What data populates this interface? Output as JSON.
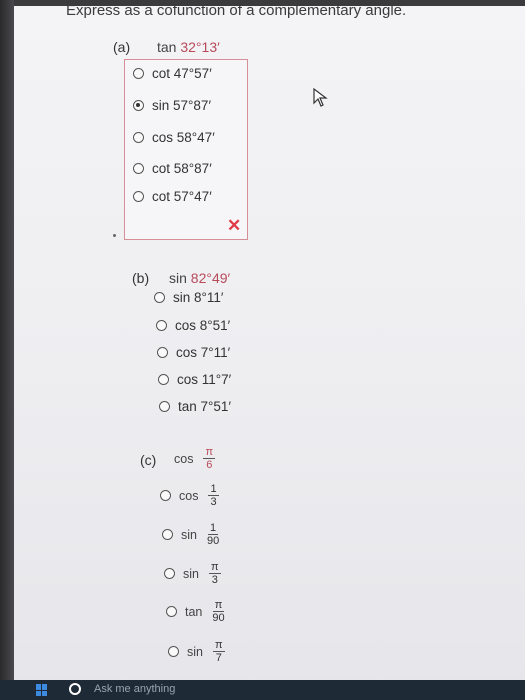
{
  "title": "Express as a cofunction of a complementary angle.",
  "part_a": {
    "label": "(a)",
    "question_fn": "tan",
    "question_angle": "32°13′",
    "options": [
      "cot 47°57′",
      "sin 57°87′",
      "cos 58°47′",
      "cot 58°87′",
      "cot 57°47′"
    ],
    "selected_index": 1,
    "result_mark": "✕"
  },
  "part_b": {
    "label": "(b)",
    "question_fn": "sin",
    "question_angle": "82°49′",
    "options": [
      "sin 8°11′",
      "cos 8°51′",
      "cos 7°11′",
      "cos 11°7′",
      "tan 7°51′"
    ]
  },
  "part_c": {
    "label": "(c)",
    "question_fn": "cos",
    "question_num": "π",
    "question_den": "6",
    "options": [
      {
        "fn": "cos",
        "num": "1",
        "den": "3"
      },
      {
        "fn": "sin",
        "num": "1",
        "den": "90"
      },
      {
        "fn": "sin",
        "num": "π",
        "den": "3"
      },
      {
        "fn": "tan",
        "num": "π",
        "den": "90"
      },
      {
        "fn": "sin",
        "num": "π",
        "den": "7"
      }
    ]
  },
  "taskbar": {
    "search_placeholder": "Ask me anything"
  },
  "colors": {
    "accent": "#b84a5a",
    "wrong": "#e03b47",
    "border": "#d88e96"
  }
}
